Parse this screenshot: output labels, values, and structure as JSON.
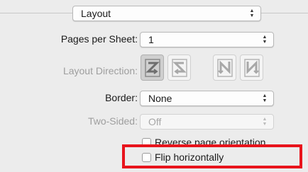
{
  "section_popup": {
    "value": "Layout"
  },
  "pages_per_sheet": {
    "label": "Pages per Sheet:",
    "value": "1"
  },
  "layout_direction": {
    "label": "Layout Direction:",
    "options": [
      "z-order-icon",
      "reverse-z-order-icon",
      "n-order-icon",
      "reverse-n-order-icon"
    ]
  },
  "border": {
    "label": "Border:",
    "value": "None"
  },
  "two_sided": {
    "label": "Two-Sided:",
    "value": "Off"
  },
  "reverse_orientation": {
    "label": "Reverse page orientation",
    "checked": false
  },
  "flip_horizontally": {
    "label": "Flip horizontally",
    "checked": false
  },
  "colors": {
    "highlight": "#e8141c",
    "disabled_text": "#9e9e9e"
  }
}
